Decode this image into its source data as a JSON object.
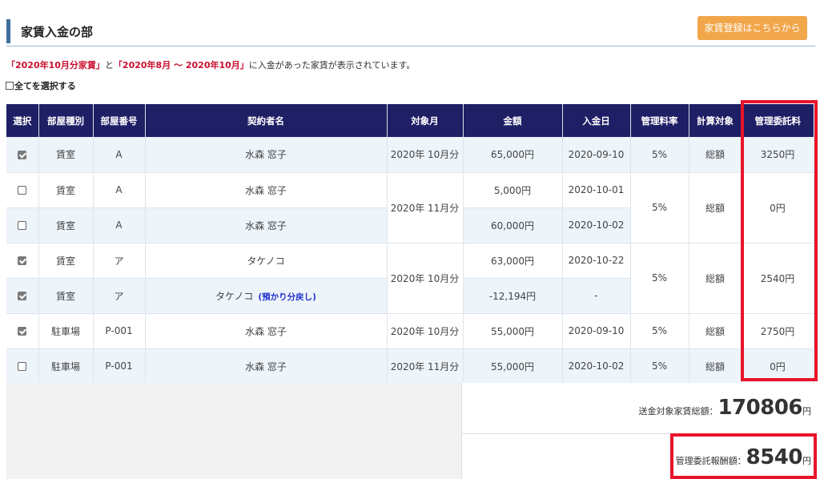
{
  "header": {
    "title": "家賃入金の部",
    "register_button": "家賃登録はこちらから"
  },
  "notice": {
    "part1": "「2020年10月分家賃」",
    "part2": "と",
    "part3": "「2020年8月 ～ 2020年10月」",
    "part4": "に入金があった家賃が表示されています。"
  },
  "select_all_label": "全てを選択する",
  "table": {
    "columns": [
      "選択",
      "部屋種別",
      "部屋番号",
      "契約者名",
      "対象月",
      "金額",
      "入金日",
      "管理料率",
      "計算対象",
      "管理委託料"
    ],
    "rows": [
      {
        "checked": true,
        "type": "賃室",
        "number": "A",
        "name": "水森 窓子",
        "name_note": "",
        "month": "2020年 10月分",
        "amount": "65,000円",
        "date": "2020-09-10",
        "rate": "5%",
        "target": "総額",
        "fee": "3250円"
      },
      {
        "checked": false,
        "type": "賃室",
        "number": "A",
        "name": "水森 窓子",
        "name_note": "",
        "month": "2020年 11月分",
        "amount": "5,000円",
        "date": "2020-10-01",
        "rate": "5%",
        "target": "総額",
        "fee": "0円"
      },
      {
        "checked": false,
        "type": "賃室",
        "number": "A",
        "name": "水森 窓子",
        "name_note": "",
        "month": "",
        "amount": "60,000円",
        "date": "2020-10-02",
        "rate": "",
        "target": "",
        "fee": ""
      },
      {
        "checked": true,
        "type": "賃室",
        "number": "ア",
        "name": "タケノコ",
        "name_note": "",
        "month": "2020年 10月分",
        "amount": "63,000円",
        "date": "2020-10-22",
        "rate": "5%",
        "target": "総額",
        "fee": "2540円"
      },
      {
        "checked": true,
        "type": "賃室",
        "number": "ア",
        "name": "タケノコ",
        "name_note": "(預かり分戻し)",
        "month": "",
        "amount": "-12,194円",
        "date": "-",
        "rate": "",
        "target": "",
        "fee": ""
      },
      {
        "checked": true,
        "type": "駐車場",
        "number": "P-001",
        "name": "水森 窓子",
        "name_note": "",
        "month": "2020年 10月分",
        "amount": "55,000円",
        "date": "2020-09-10",
        "rate": "5%",
        "target": "総額",
        "fee": "2750円"
      },
      {
        "checked": false,
        "type": "駐車場",
        "number": "P-001",
        "name": "水森 窓子",
        "name_note": "",
        "month": "2020年 11月分",
        "amount": "55,000円",
        "date": "2020-10-02",
        "rate": "5%",
        "target": "総額",
        "fee": "0円"
      }
    ]
  },
  "summary": {
    "total_label": "送金対象家賃総額：",
    "total_value": "170806",
    "fee_label": "管理委託報酬額：",
    "fee_value": "8540",
    "unit": "円"
  },
  "colors": {
    "header_bg": "#1f1f66",
    "accent_bar": "#3f6e9e",
    "button": "#f2a64a",
    "notice_red": "#c8102e",
    "highlight_box": "#e8142a",
    "row_alt": "#edf4fa"
  }
}
